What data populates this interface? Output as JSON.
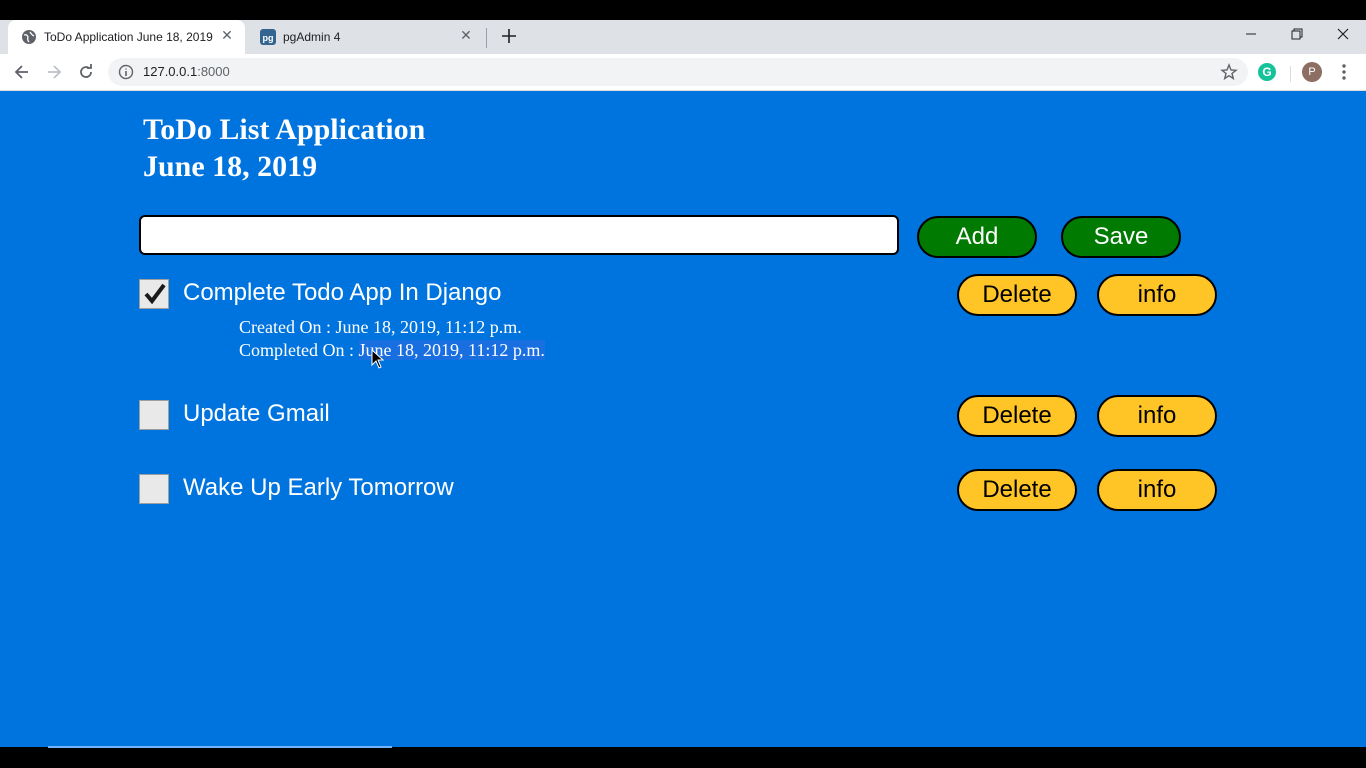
{
  "browser": {
    "tabs": [
      {
        "title": "ToDo Application June 18, 2019",
        "active": true,
        "icon": "globe-icon"
      },
      {
        "title": "pgAdmin 4",
        "active": false,
        "icon": "pgadmin-icon"
      }
    ],
    "url_host": "127.0.0.1",
    "url_port": ":8000",
    "extension_label": "G",
    "profile_initial": "P"
  },
  "page": {
    "title": "ToDo List Application",
    "date": "June 18, 2019",
    "input_value": "",
    "add_label": "Add",
    "save_label": "Save",
    "colors": {
      "background": "#0074de",
      "primary_button": "#007a00",
      "secondary_button": "#ffc425"
    }
  },
  "todos": [
    {
      "text": "Complete Todo App In Django",
      "completed": true,
      "created_label": "Created On : ",
      "created_value": "June 18, 2019, 11:12 p.m.",
      "completed_label": "Completed On : ",
      "completed_value": "June 18, 2019, 11:12 p.m.",
      "delete_label": "Delete",
      "info_label": "info"
    },
    {
      "text": "Update Gmail",
      "completed": false,
      "delete_label": "Delete",
      "info_label": "info"
    },
    {
      "text": "Wake Up Early Tomorrow",
      "completed": false,
      "delete_label": "Delete",
      "info_label": "info"
    }
  ]
}
